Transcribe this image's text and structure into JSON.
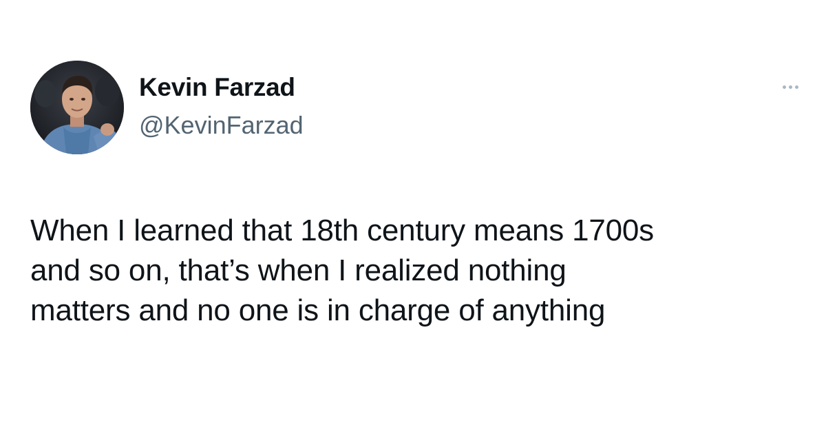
{
  "author": {
    "display_name": "Kevin Farzad",
    "handle": "@KevinFarzad",
    "avatar_icon": "profile-photo"
  },
  "menu": {
    "icon": "more-options-icon"
  },
  "tweet": {
    "lines": [
      "When I learned that 18th century means 1700s",
      "and so on, that’s when I realized nothing",
      "matters and no one is in charge of anything"
    ]
  },
  "colors": {
    "text": "#0f1419",
    "secondary_text": "#536471",
    "background": "#ffffff"
  }
}
